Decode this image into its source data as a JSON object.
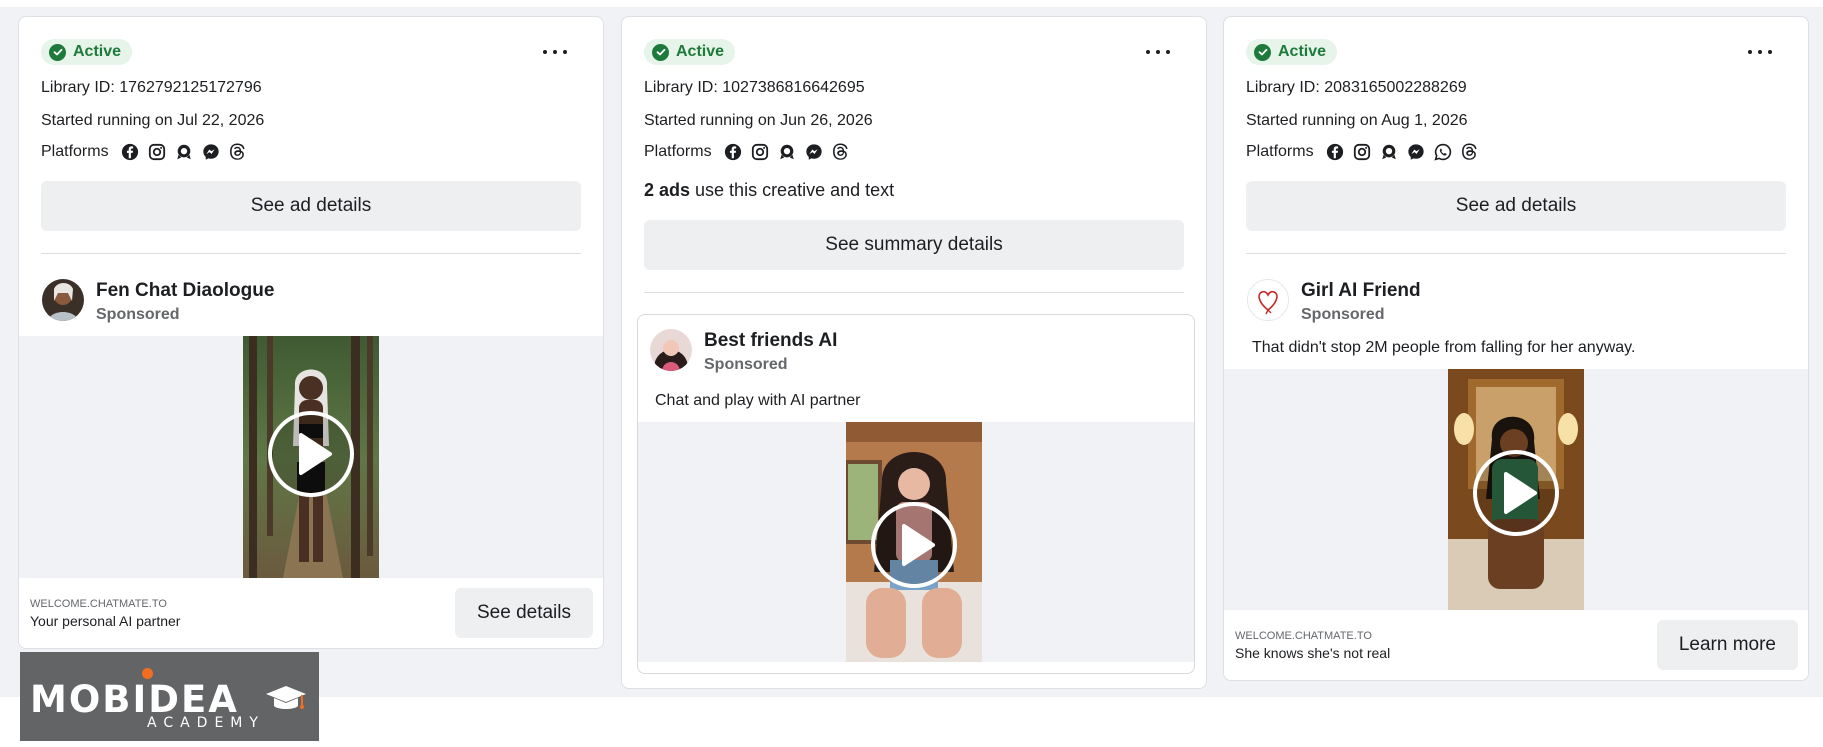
{
  "cards": [
    {
      "status": "Active",
      "library_id": "Library ID: 1762792125172796",
      "started": "Started running on Jul 22, 2026",
      "platforms_label": "Platforms",
      "platform_icons": [
        "facebook-icon",
        "instagram-icon",
        "audience-network-icon",
        "messenger-icon",
        "threads-icon"
      ],
      "details_button": "See ad details",
      "advertiser": "Fen Chat Diaologue",
      "sponsored": "Sponsored",
      "domain": "WELCOME.CHATMATE.TO",
      "caption": "Your personal AI partner",
      "cta": "See details"
    },
    {
      "status": "Active",
      "library_id": "Library ID: 1027386816642695",
      "started": "Started running on Jun 26, 2026",
      "platforms_label": "Platforms",
      "platform_icons": [
        "facebook-icon",
        "instagram-icon",
        "audience-network-icon",
        "messenger-icon",
        "threads-icon"
      ],
      "ads_count_bold": "2 ads",
      "ads_count_rest": " use this creative and text",
      "details_button": "See summary details",
      "advertiser": "Best friends AI",
      "sponsored": "Sponsored",
      "body_text": "Chat and play with AI partner"
    },
    {
      "status": "Active",
      "library_id": "Library ID: 2083165002288269",
      "started": "Started running on Aug 1, 2026",
      "platforms_label": "Platforms",
      "platform_icons": [
        "facebook-icon",
        "instagram-icon",
        "audience-network-icon",
        "messenger-icon",
        "whatsapp-icon",
        "threads-icon"
      ],
      "details_button": "See ad details",
      "advertiser": "Girl AI Friend",
      "sponsored": "Sponsored",
      "body_text": "That didn't stop 2M people from falling for her anyway.",
      "domain": "WELCOME.CHATMATE.TO",
      "caption": "She knows she's not real",
      "cta": "Learn more"
    }
  ],
  "watermark": {
    "brand": "MOBIDEA",
    "sub": "ACADEMY"
  },
  "colors": {
    "page_bg": "#f0f2f5",
    "active_green": "#1e7a3a",
    "active_bg": "#e6f4ea",
    "logo_bg": "#636466",
    "logo_accent": "#f36d21"
  }
}
